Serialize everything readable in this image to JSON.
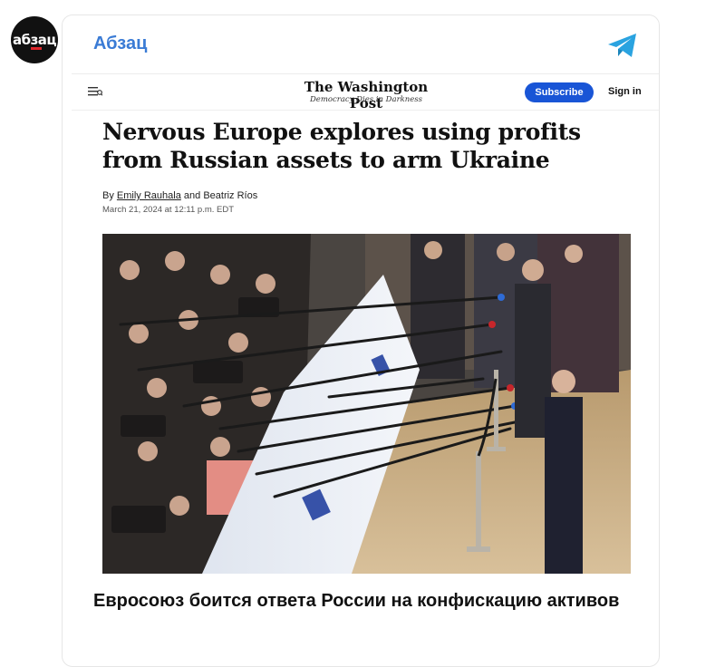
{
  "channel": {
    "avatar_text": "абзац",
    "name": "Абзац"
  },
  "article_preview": {
    "publication_logo": "The Washington Post",
    "publication_tagline": "Democracy Dies in Darkness",
    "subscribe_label": "Subscribe",
    "signin_label": "Sign in",
    "headline": "Nervous Europe explores using profits from Russian assets to arm Ukraine",
    "byline_prefix": "By",
    "author_1": "Emily Rauhala",
    "byline_and": "and",
    "author_2": "Beatriz Ríos",
    "date": "March 21, 2024 at 12:11 p.m. EDT"
  },
  "post": {
    "caption": "Евросоюз боится ответа России на конфискацию активов"
  },
  "colors": {
    "channel_name": "#3a7bd5",
    "telegram_icon": "#2aa3e0",
    "subscribe_button": "#1955d6",
    "avatar_bg": "#111111",
    "avatar_accent": "#e0262b"
  },
  "icons": {
    "share": "telegram-icon",
    "menu": "menu-icon"
  }
}
